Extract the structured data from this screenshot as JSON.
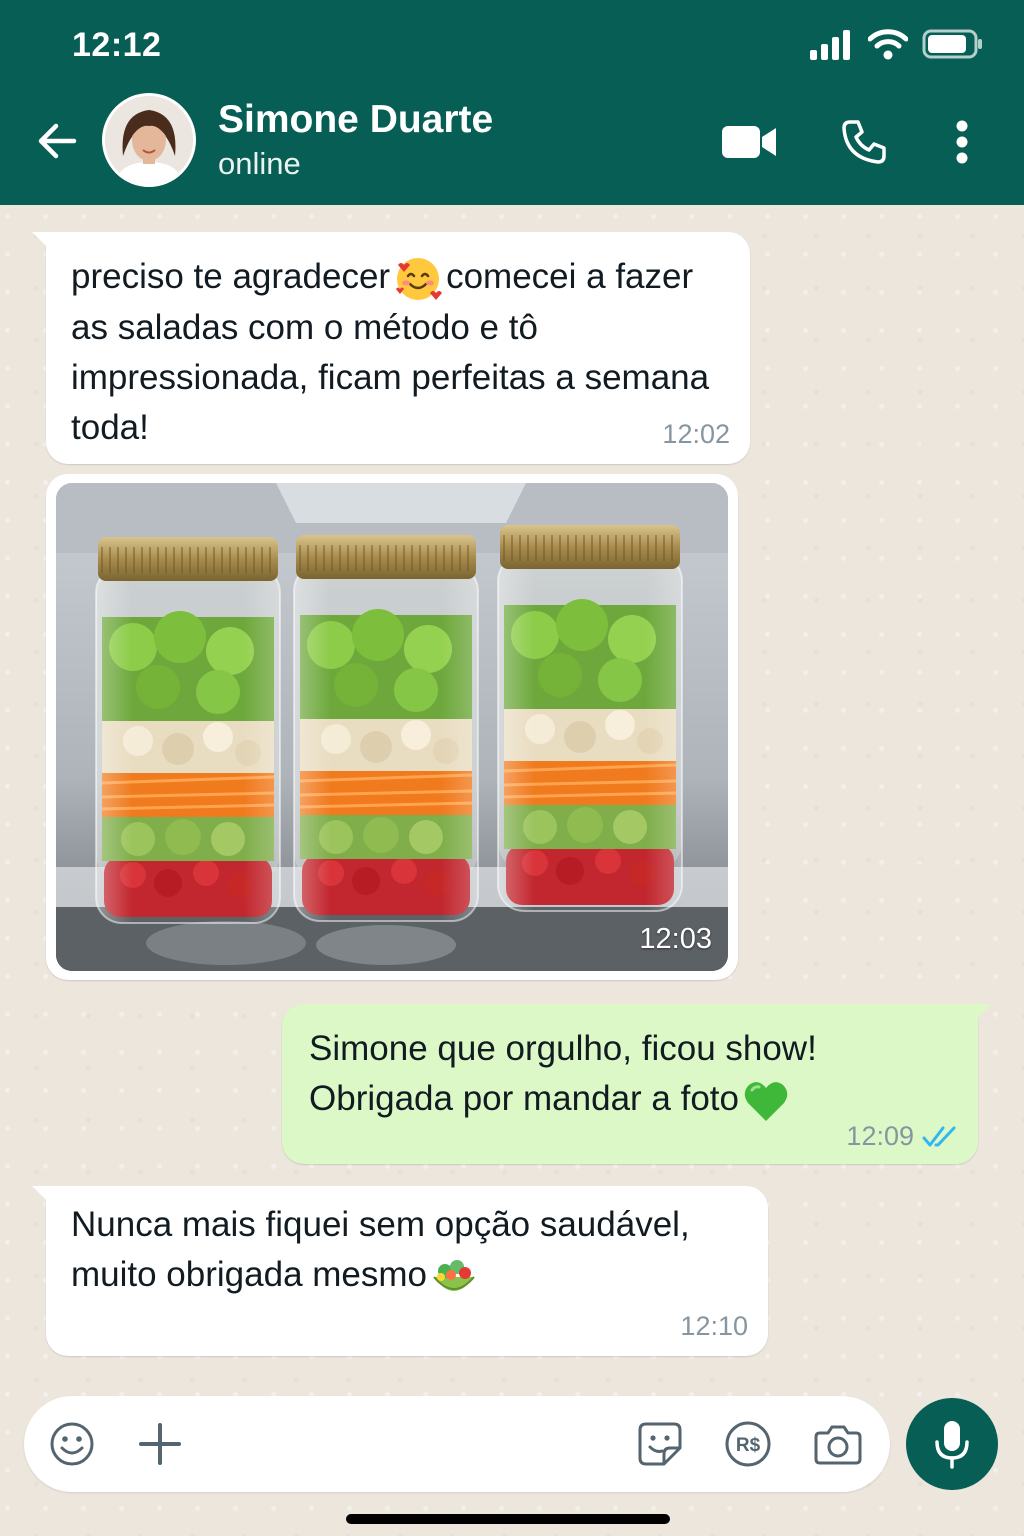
{
  "status_bar": {
    "time": "12:12"
  },
  "contact": {
    "name": "Simone Duarte",
    "status": "online"
  },
  "messages": [
    {
      "direction": "in",
      "text_parts": [
        "preciso te agradecer",
        "comecei a fazer as saladas com o método e tô impressionada, ficam perfeitas a semana toda!"
      ],
      "emoji": "smiling-face-with-hearts",
      "time": "12:02"
    },
    {
      "direction": "in",
      "type": "photo",
      "alt": "three salad jars in refrigerator",
      "time": "12:03"
    },
    {
      "direction": "out",
      "text_parts": [
        "Simone que orgulho, ficou show! Obrigada por mandar a foto"
      ],
      "emoji": "green-heart",
      "time": "12:09",
      "receipt": "read"
    },
    {
      "direction": "in",
      "text_parts": [
        "Nunca mais fiquei sem opção saudável, muito obrigada mesmo"
      ],
      "emoji": "green-salad",
      "time": "12:10"
    }
  ],
  "composer": {
    "placeholder": "",
    "pay_label": "R$"
  },
  "colors": {
    "header": "#075e54",
    "bubble_in": "#ffffff",
    "bubble_out": "#dcf8c6",
    "read_receipt": "#34b7f1",
    "wallpaper": "#ece6dd"
  }
}
